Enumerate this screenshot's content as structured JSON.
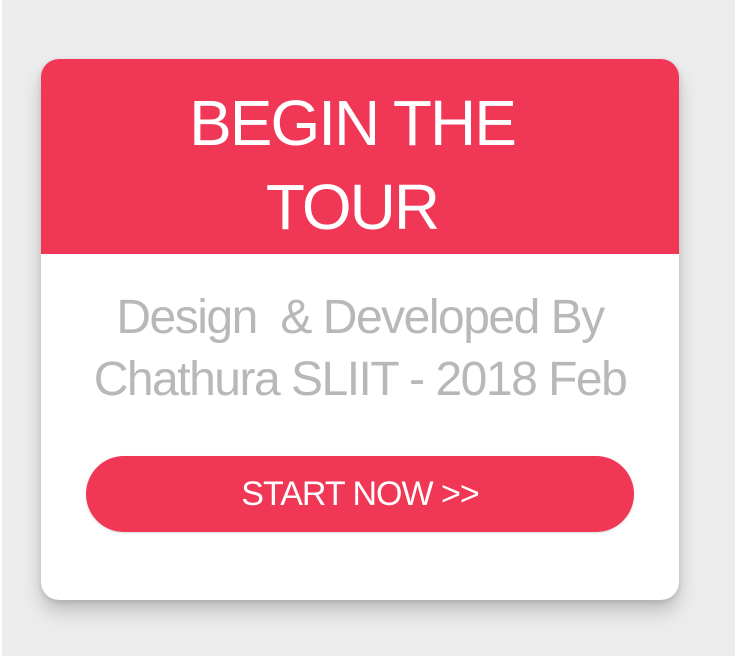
{
  "header": {
    "title_line1": "BEGIN THE",
    "title_line2": "TOUR"
  },
  "credits": {
    "line1": "Design  & Developed By",
    "line2": "Chathura SLIIT - 2018 Feb"
  },
  "cta": {
    "label": "START NOW >>"
  },
  "colors": {
    "accent": "#f03756",
    "credit_text": "#b8b8b8",
    "card_background": "#ffffff",
    "page_background": "#ececec"
  }
}
